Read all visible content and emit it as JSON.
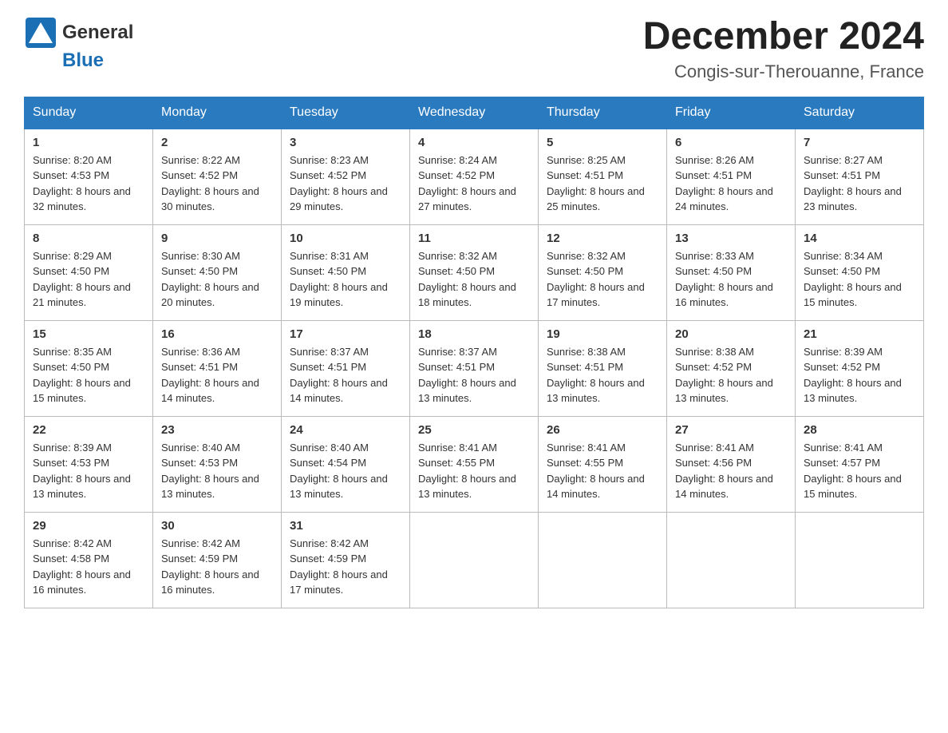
{
  "header": {
    "logo": {
      "general": "General",
      "blue": "Blue"
    },
    "month_title": "December 2024",
    "location": "Congis-sur-Therouanne, France"
  },
  "days_of_week": [
    "Sunday",
    "Monday",
    "Tuesday",
    "Wednesday",
    "Thursday",
    "Friday",
    "Saturday"
  ],
  "weeks": [
    {
      "days": [
        {
          "num": "1",
          "sunrise": "8:20 AM",
          "sunset": "4:53 PM",
          "daylight": "8 hours and 32 minutes."
        },
        {
          "num": "2",
          "sunrise": "8:22 AM",
          "sunset": "4:52 PM",
          "daylight": "8 hours and 30 minutes."
        },
        {
          "num": "3",
          "sunrise": "8:23 AM",
          "sunset": "4:52 PM",
          "daylight": "8 hours and 29 minutes."
        },
        {
          "num": "4",
          "sunrise": "8:24 AM",
          "sunset": "4:52 PM",
          "daylight": "8 hours and 27 minutes."
        },
        {
          "num": "5",
          "sunrise": "8:25 AM",
          "sunset": "4:51 PM",
          "daylight": "8 hours and 25 minutes."
        },
        {
          "num": "6",
          "sunrise": "8:26 AM",
          "sunset": "4:51 PM",
          "daylight": "8 hours and 24 minutes."
        },
        {
          "num": "7",
          "sunrise": "8:27 AM",
          "sunset": "4:51 PM",
          "daylight": "8 hours and 23 minutes."
        }
      ]
    },
    {
      "days": [
        {
          "num": "8",
          "sunrise": "8:29 AM",
          "sunset": "4:50 PM",
          "daylight": "8 hours and 21 minutes."
        },
        {
          "num": "9",
          "sunrise": "8:30 AM",
          "sunset": "4:50 PM",
          "daylight": "8 hours and 20 minutes."
        },
        {
          "num": "10",
          "sunrise": "8:31 AM",
          "sunset": "4:50 PM",
          "daylight": "8 hours and 19 minutes."
        },
        {
          "num": "11",
          "sunrise": "8:32 AM",
          "sunset": "4:50 PM",
          "daylight": "8 hours and 18 minutes."
        },
        {
          "num": "12",
          "sunrise": "8:32 AM",
          "sunset": "4:50 PM",
          "daylight": "8 hours and 17 minutes."
        },
        {
          "num": "13",
          "sunrise": "8:33 AM",
          "sunset": "4:50 PM",
          "daylight": "8 hours and 16 minutes."
        },
        {
          "num": "14",
          "sunrise": "8:34 AM",
          "sunset": "4:50 PM",
          "daylight": "8 hours and 15 minutes."
        }
      ]
    },
    {
      "days": [
        {
          "num": "15",
          "sunrise": "8:35 AM",
          "sunset": "4:50 PM",
          "daylight": "8 hours and 15 minutes."
        },
        {
          "num": "16",
          "sunrise": "8:36 AM",
          "sunset": "4:51 PM",
          "daylight": "8 hours and 14 minutes."
        },
        {
          "num": "17",
          "sunrise": "8:37 AM",
          "sunset": "4:51 PM",
          "daylight": "8 hours and 14 minutes."
        },
        {
          "num": "18",
          "sunrise": "8:37 AM",
          "sunset": "4:51 PM",
          "daylight": "8 hours and 13 minutes."
        },
        {
          "num": "19",
          "sunrise": "8:38 AM",
          "sunset": "4:51 PM",
          "daylight": "8 hours and 13 minutes."
        },
        {
          "num": "20",
          "sunrise": "8:38 AM",
          "sunset": "4:52 PM",
          "daylight": "8 hours and 13 minutes."
        },
        {
          "num": "21",
          "sunrise": "8:39 AM",
          "sunset": "4:52 PM",
          "daylight": "8 hours and 13 minutes."
        }
      ]
    },
    {
      "days": [
        {
          "num": "22",
          "sunrise": "8:39 AM",
          "sunset": "4:53 PM",
          "daylight": "8 hours and 13 minutes."
        },
        {
          "num": "23",
          "sunrise": "8:40 AM",
          "sunset": "4:53 PM",
          "daylight": "8 hours and 13 minutes."
        },
        {
          "num": "24",
          "sunrise": "8:40 AM",
          "sunset": "4:54 PM",
          "daylight": "8 hours and 13 minutes."
        },
        {
          "num": "25",
          "sunrise": "8:41 AM",
          "sunset": "4:55 PM",
          "daylight": "8 hours and 13 minutes."
        },
        {
          "num": "26",
          "sunrise": "8:41 AM",
          "sunset": "4:55 PM",
          "daylight": "8 hours and 14 minutes."
        },
        {
          "num": "27",
          "sunrise": "8:41 AM",
          "sunset": "4:56 PM",
          "daylight": "8 hours and 14 minutes."
        },
        {
          "num": "28",
          "sunrise": "8:41 AM",
          "sunset": "4:57 PM",
          "daylight": "8 hours and 15 minutes."
        }
      ]
    },
    {
      "days": [
        {
          "num": "29",
          "sunrise": "8:42 AM",
          "sunset": "4:58 PM",
          "daylight": "8 hours and 16 minutes."
        },
        {
          "num": "30",
          "sunrise": "8:42 AM",
          "sunset": "4:59 PM",
          "daylight": "8 hours and 16 minutes."
        },
        {
          "num": "31",
          "sunrise": "8:42 AM",
          "sunset": "4:59 PM",
          "daylight": "8 hours and 17 minutes."
        },
        null,
        null,
        null,
        null
      ]
    }
  ],
  "labels": {
    "sunrise": "Sunrise:",
    "sunset": "Sunset:",
    "daylight": "Daylight:"
  }
}
